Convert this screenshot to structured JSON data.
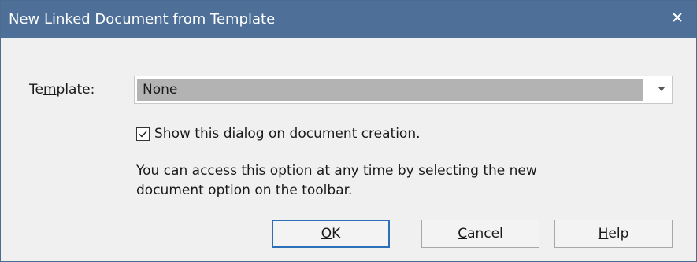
{
  "window": {
    "title": "New Linked Document from Template",
    "close_icon": "close-icon"
  },
  "template": {
    "label_prefix": "Te",
    "label_mnemonic": "m",
    "label_suffix": "plate:",
    "selected_value": "None"
  },
  "show_dialog": {
    "checked": true,
    "label": "Show this dialog on document creation."
  },
  "info": {
    "line1": "You can access this option at any time by selecting the new",
    "line2": "document option on the toolbar."
  },
  "buttons": {
    "ok_mnemonic": "O",
    "ok_rest": "K",
    "cancel_mnemonic": "C",
    "cancel_rest": "ancel",
    "help_mnemonic": "H",
    "help_rest": "elp"
  },
  "colors": {
    "titlebar": "#4d6f98",
    "dialog_bg": "#f0f0f0",
    "combo_selection": "#b3b3b3",
    "default_button_border": "#2d6fb8"
  }
}
